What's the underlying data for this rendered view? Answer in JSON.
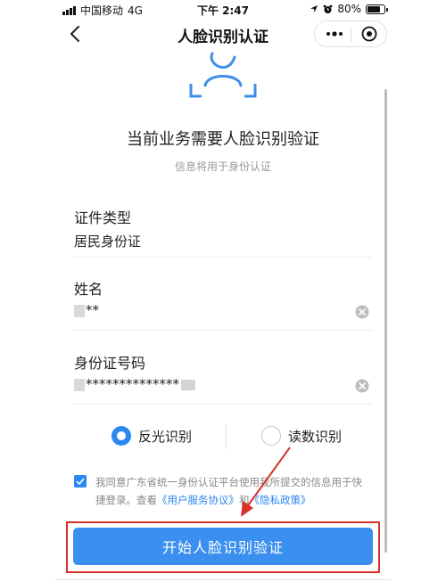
{
  "status_bar": {
    "carrier": "中国移动",
    "network": "4G",
    "time": "下午 2:47",
    "battery_percent": "80%",
    "battery_level": 0.8
  },
  "nav": {
    "title": "人脸识别认证"
  },
  "intro": {
    "headline": "当前业务需要人脸识别验证",
    "subline": "信息将用于身份认证"
  },
  "fields": {
    "id_type_label": "证件类型",
    "id_type_value": "居民身份证",
    "name_label": "姓名",
    "name_value": "**",
    "id_number_label": "身份证号码",
    "id_number_value": "**************"
  },
  "recognition": {
    "option_reflect": "反光识别",
    "option_read_digits": "读数识别",
    "selected": "反光识别"
  },
  "agreement": {
    "text_before": "我同意广东省统一身份认证平台使用我所提交的信息用于快捷登录。查看",
    "service_link": "《用户服务协议》",
    "conjunction": "和",
    "privacy_link": "《隐私政策》",
    "checked": true
  },
  "cta": {
    "label": "开始人脸识别验证"
  },
  "colors": {
    "accent": "#2c87f0",
    "button": "#3b8fef",
    "annotation": "#d9302a"
  }
}
